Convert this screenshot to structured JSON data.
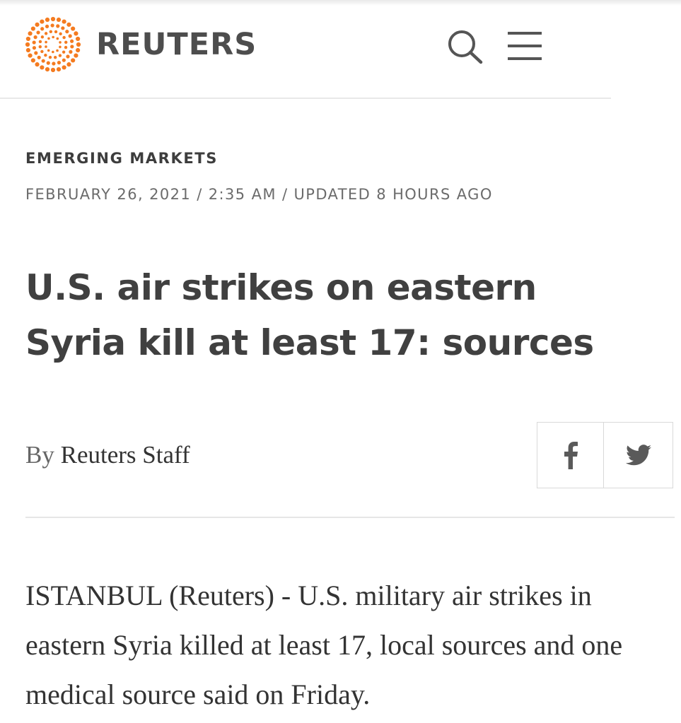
{
  "header": {
    "brand_name": "REUTERS",
    "icons": {
      "logo": "reuters-dot-ring-logo",
      "search": "search-icon",
      "menu": "hamburger-menu-icon"
    }
  },
  "article": {
    "section": "EMERGING MARKETS",
    "dateline": "FEBRUARY 26, 2021 / 2:35 AM / UPDATED 8 HOURS AGO",
    "headline": "U.S. air strikes on eastern Syria kill at least 17: sources",
    "byline_prefix": "By",
    "author": "Reuters Staff",
    "share": {
      "facebook_icon": "facebook-icon",
      "twitter_icon": "twitter-icon"
    },
    "body": "ISTANBUL (Reuters) - U.S. military air strikes in eastern Syria killed at least 17, local sources and one medical source said on Friday."
  },
  "colors": {
    "brand_orange": "#f47b20",
    "text_dark": "#404040",
    "text_meta": "#6b6b6b",
    "divider": "#e6e6e6"
  }
}
